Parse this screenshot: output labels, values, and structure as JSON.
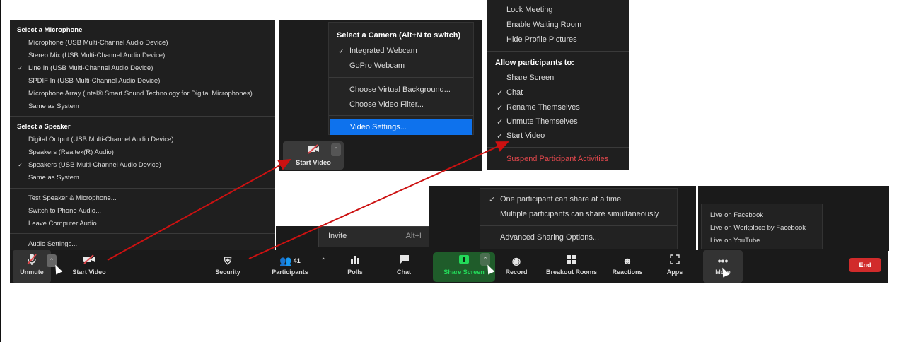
{
  "audio_menu": {
    "mic_header": "Select a Microphone",
    "mics": [
      {
        "label": "Microphone (USB Multi-Channel Audio Device)",
        "checked": false
      },
      {
        "label": "Stereo Mix (USB Multi-Channel Audio Device)",
        "checked": false
      },
      {
        "label": "Line In (USB Multi-Channel Audio Device)",
        "checked": true
      },
      {
        "label": "SPDIF In (USB Multi-Channel Audio Device)",
        "checked": false
      },
      {
        "label": "Microphone Array (Intel® Smart Sound Technology for Digital Microphones)",
        "checked": false
      },
      {
        "label": "Same as System",
        "checked": false
      }
    ],
    "speaker_header": "Select a Speaker",
    "speakers": [
      {
        "label": "Digital Output (USB Multi-Channel Audio Device)",
        "checked": false
      },
      {
        "label": "Speakers (Realtek(R) Audio)",
        "checked": false
      },
      {
        "label": "Speakers (USB Multi-Channel Audio Device)",
        "checked": true
      },
      {
        "label": "Same as System",
        "checked": false
      }
    ],
    "actions": [
      "Test Speaker & Microphone...",
      "Switch to Phone Audio...",
      "Leave Computer Audio"
    ],
    "settings": "Audio Settings..."
  },
  "camera_menu": {
    "header": "Select a Camera (Alt+N to switch)",
    "cameras": [
      {
        "label": "Integrated Webcam",
        "checked": true
      },
      {
        "label": "GoPro Webcam",
        "checked": false
      }
    ],
    "options": [
      "Choose Virtual Background...",
      "Choose Video Filter..."
    ],
    "settings": "Video Settings...",
    "button_label": "Start Video"
  },
  "security_menu": {
    "items": [
      "Lock Meeting",
      "Enable Waiting Room",
      "Hide Profile Pictures"
    ],
    "allow_header": "Allow participants to:",
    "allow_items": [
      {
        "label": "Share Screen",
        "checked": false
      },
      {
        "label": "Chat",
        "checked": true
      },
      {
        "label": "Rename Themselves",
        "checked": true
      },
      {
        "label": "Unmute Themselves",
        "checked": true
      },
      {
        "label": "Start Video",
        "checked": true
      }
    ],
    "suspend": "Suspend Participant Activities"
  },
  "share_menu": {
    "options": [
      {
        "label": "One participant can share at a time",
        "checked": true
      },
      {
        "label": "Multiple participants can share simultaneously",
        "checked": false
      }
    ],
    "advanced": "Advanced Sharing Options..."
  },
  "invite_menu": {
    "label": "Invite",
    "shortcut": "Alt+I"
  },
  "live_menu": {
    "items": [
      "Live on Facebook",
      "Live on Workplace by Facebook",
      "Live on YouTube"
    ]
  },
  "toolbar": {
    "unmute": "Unmute",
    "start_video": "Start Video",
    "security": "Security",
    "participants": "Participants",
    "participant_count": "41",
    "polls": "Polls",
    "chat": "Chat",
    "share_screen": "Share Screen",
    "record": "Record",
    "breakout_rooms": "Breakout Rooms",
    "reactions": "Reactions",
    "apps": "Apps",
    "more": "More",
    "end": "End"
  },
  "colors": {
    "accent_blue": "#0e72ed",
    "share_green": "#23d959",
    "end_red": "#d12b2b",
    "arrow_red": "#cc1111",
    "danger": "#e0474c"
  }
}
